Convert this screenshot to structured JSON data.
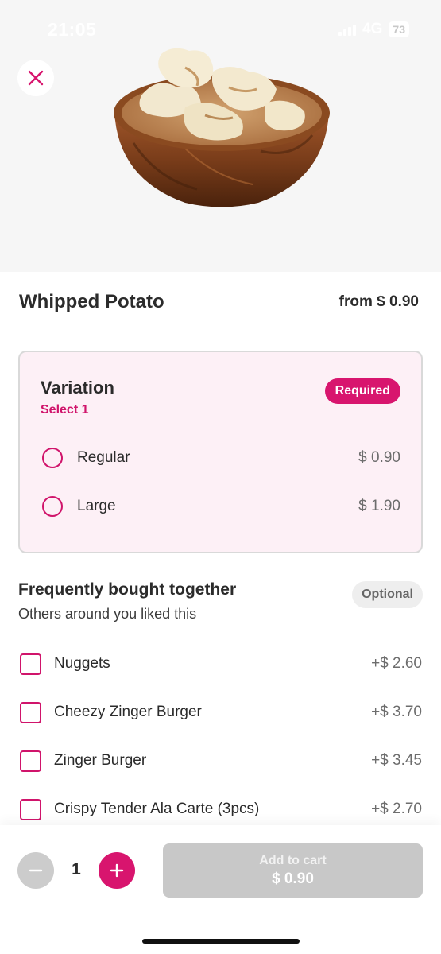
{
  "status_bar": {
    "time": "21:05",
    "network": "4G",
    "battery": "73"
  },
  "header": {
    "close_icon": "close-icon",
    "product_image": "whipped-potato-bowl"
  },
  "product": {
    "name": "Whipped Potato",
    "price_from": "from $ 0.90"
  },
  "variation": {
    "title": "Variation",
    "subtitle": "Select 1",
    "badge": "Required",
    "options": [
      {
        "label": "Regular",
        "price": "$ 0.90"
      },
      {
        "label": "Large",
        "price": "$ 1.90"
      }
    ]
  },
  "frequently_bought": {
    "title": "Frequently bought together",
    "subtitle": "Others around you liked this",
    "badge": "Optional",
    "items": [
      {
        "label": "Nuggets",
        "price": "+$ 2.60"
      },
      {
        "label": "Cheezy Zinger Burger",
        "price": "+$ 3.70"
      },
      {
        "label": "Zinger Burger",
        "price": "+$ 3.45"
      },
      {
        "label": "Crispy Tender Ala Carte (3pcs)",
        "price": "+$ 2.70"
      }
    ]
  },
  "cart": {
    "quantity": "1",
    "add_label": "Add to cart",
    "add_price": "$ 0.90"
  },
  "colors": {
    "accent": "#d8156e",
    "panel_bg": "#fdf0f6",
    "disabled": "#c8c8c8"
  }
}
